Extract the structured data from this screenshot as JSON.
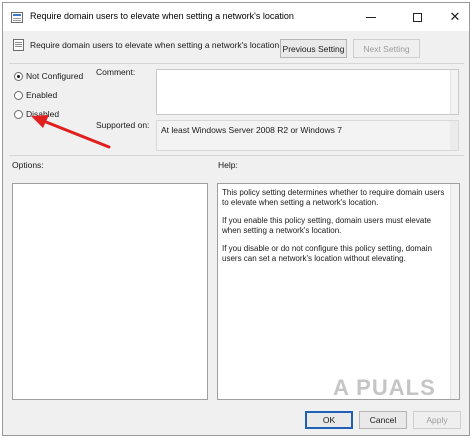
{
  "window": {
    "title": "Require domain users to elevate when setting a network's location",
    "close_glyph": "✕"
  },
  "header": {
    "policy_title": "Require domain users to elevate when setting a network's location",
    "previous_label": "Previous Setting",
    "next_label": "Next Setting"
  },
  "state": {
    "options": [
      {
        "label": "Not Configured",
        "checked": true
      },
      {
        "label": "Enabled",
        "checked": false
      },
      {
        "label": "Disabled",
        "checked": false
      }
    ]
  },
  "comment": {
    "label": "Comment:",
    "value": ""
  },
  "supported": {
    "label": "Supported on:",
    "value": "At least Windows Server 2008 R2 or Windows 7"
  },
  "options_panel": {
    "label": "Options:"
  },
  "help_panel": {
    "label": "Help:",
    "paragraphs": [
      "This policy setting determines whether to require domain users to elevate when setting a network's location.",
      "If you enable this policy setting, domain users must elevate when setting a network's location.",
      "If you disable or do not configure this policy setting, domain users can set a network's location without elevating."
    ]
  },
  "footer": {
    "ok_label": "OK",
    "cancel_label": "Cancel",
    "apply_label": "Apply"
  },
  "watermark": "A PUALS",
  "colors": {
    "accent": "#1f5fb5",
    "arrow": "#e0201f",
    "window_bg": "#f0f0f0"
  }
}
